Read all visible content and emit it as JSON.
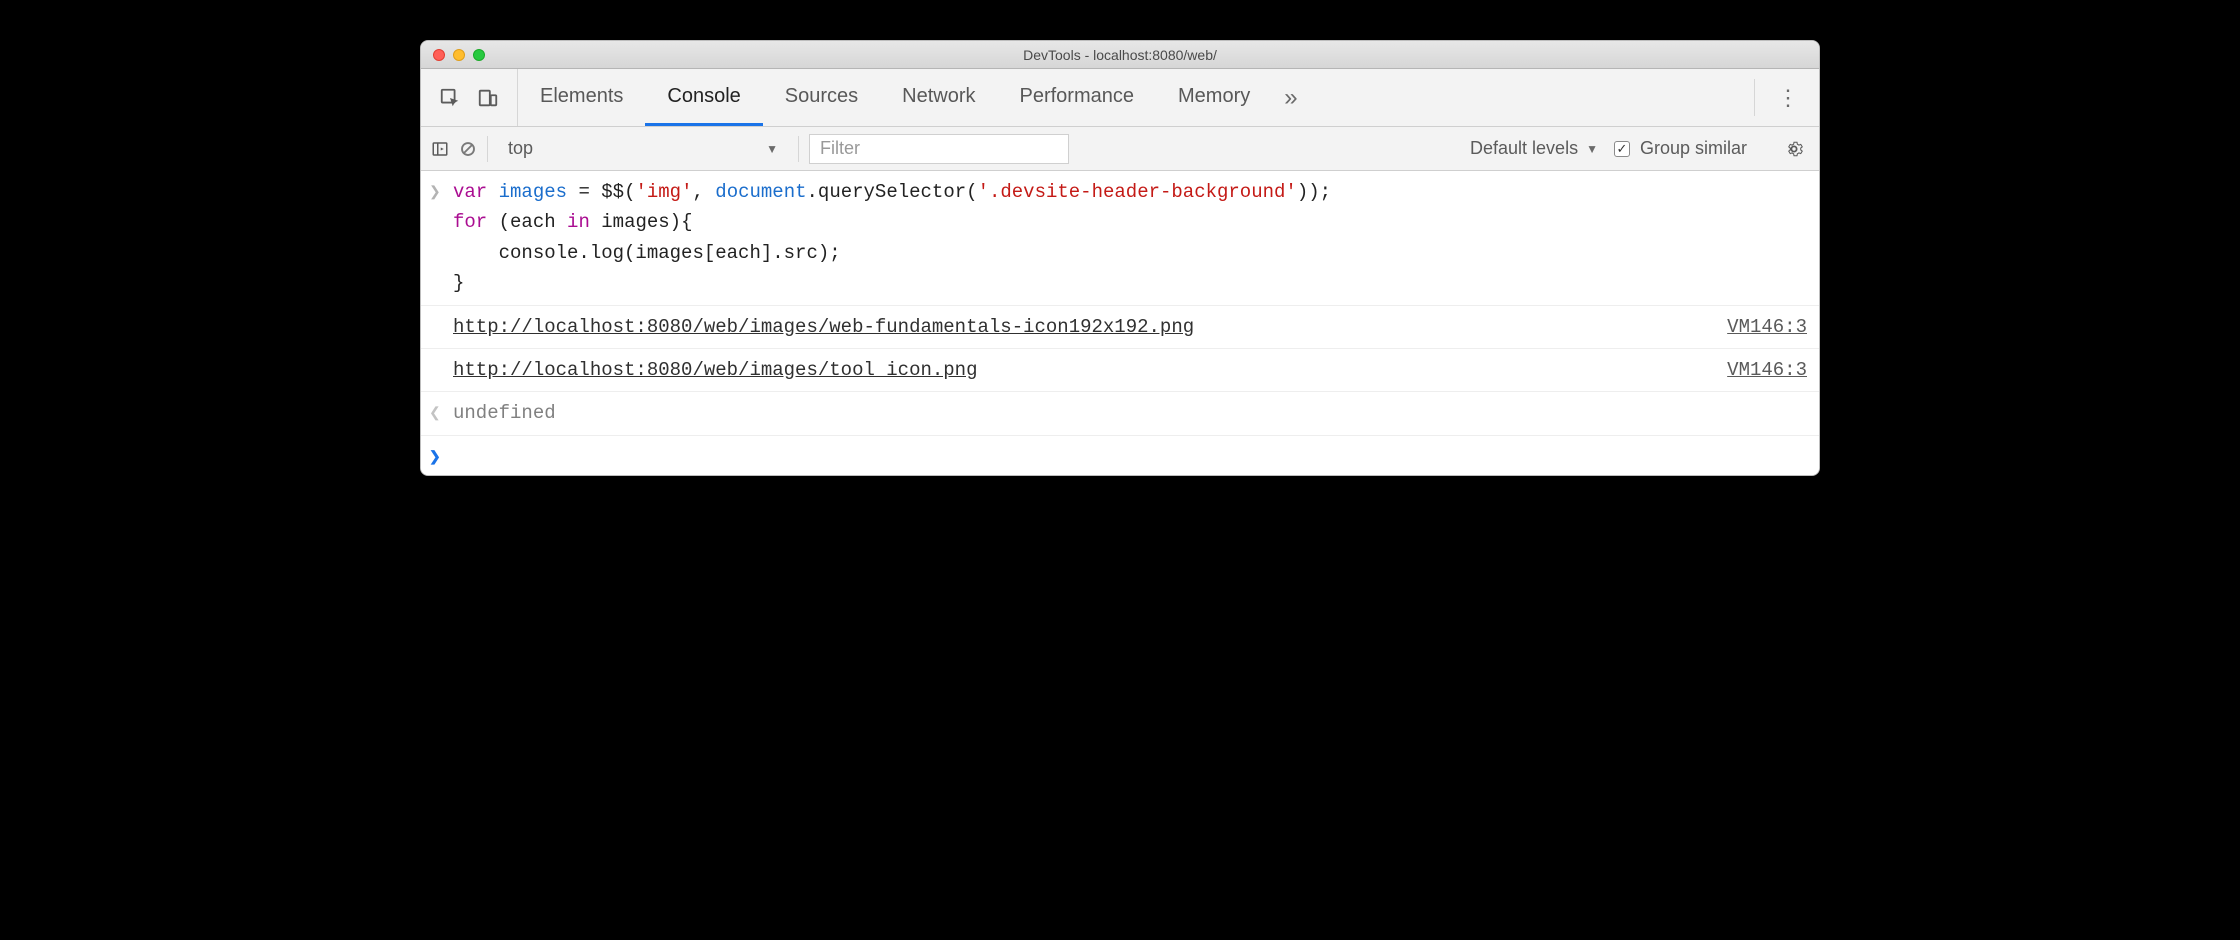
{
  "window": {
    "title": "DevTools - localhost:8080/web/"
  },
  "tabs": {
    "items": [
      "Elements",
      "Console",
      "Sources",
      "Network",
      "Performance",
      "Memory"
    ],
    "overflow_glyph": "»",
    "menu_glyph": "⋮"
  },
  "toolbar": {
    "context": "top",
    "filter_placeholder": "Filter",
    "levels_label": "Default levels",
    "group_similar_label": "Group similar",
    "group_similar_checked": "✓"
  },
  "console": {
    "input_code": {
      "l1a": "var",
      "l1b": " images ",
      "l1c": "=",
      "l1d": " $$",
      "l1e": "(",
      "l1f": "'img'",
      "l1g": ", ",
      "l1h": "document",
      "l1i": ".querySelector",
      "l1j": "(",
      "l1k": "'.devsite-header-background'",
      "l1l": "));",
      "l2a": "for",
      "l2b": " (each ",
      "l2c": "in",
      "l2d": " images){",
      "l3": "    console.log(images[each].src);",
      "l4": "}"
    },
    "logs": [
      {
        "text": "http://localhost:8080/web/images/web-fundamentals-icon192x192.png",
        "source": "VM146:3"
      },
      {
        "text": "http://localhost:8080/web/images/tool_icon.png",
        "source": "VM146:3"
      }
    ],
    "return_value": "undefined"
  }
}
